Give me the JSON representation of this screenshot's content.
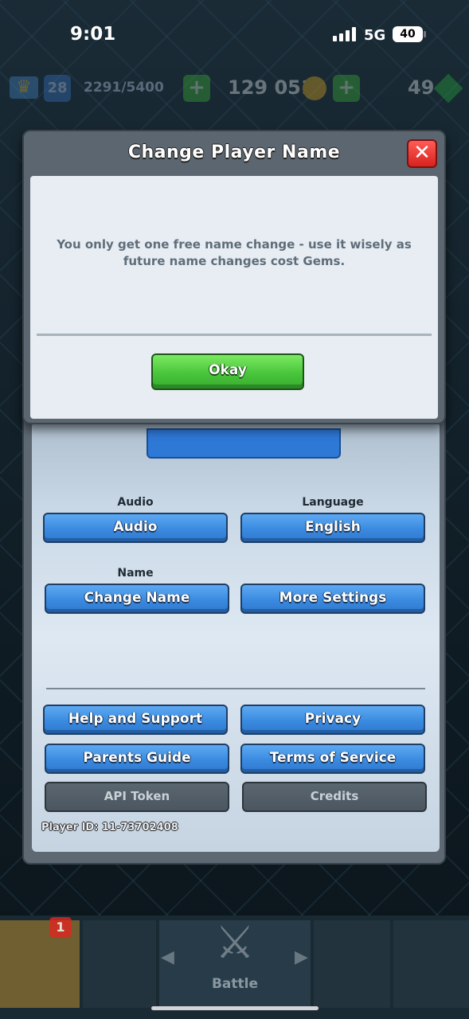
{
  "status_bar": {
    "time": "9:01",
    "network": "5G",
    "battery": "40"
  },
  "top_bar": {
    "level": "28",
    "xp": "2291/5400",
    "gold": "129 051",
    "gems": "49"
  },
  "settings": {
    "audio_label": "Audio",
    "audio_button": "Audio",
    "language_label": "Language",
    "language_button": "English",
    "name_label": "Name",
    "change_name_button": "Change Name",
    "more_settings_button": "More Settings",
    "help_button": "Help and Support",
    "privacy_button": "Privacy",
    "parents_button": "Parents Guide",
    "terms_button": "Terms of Service",
    "api_button": "API Token",
    "credits_button": "Credits",
    "player_id": "Player ID: 11-73702408"
  },
  "modal": {
    "title": "Change Player Name",
    "message": "You only get one free name change - use it wisely as future name changes cost Gems.",
    "okay_button": "Okay",
    "close_glyph": "✕"
  },
  "bottom_nav": {
    "badge": "1",
    "battle_label": "Battle"
  }
}
